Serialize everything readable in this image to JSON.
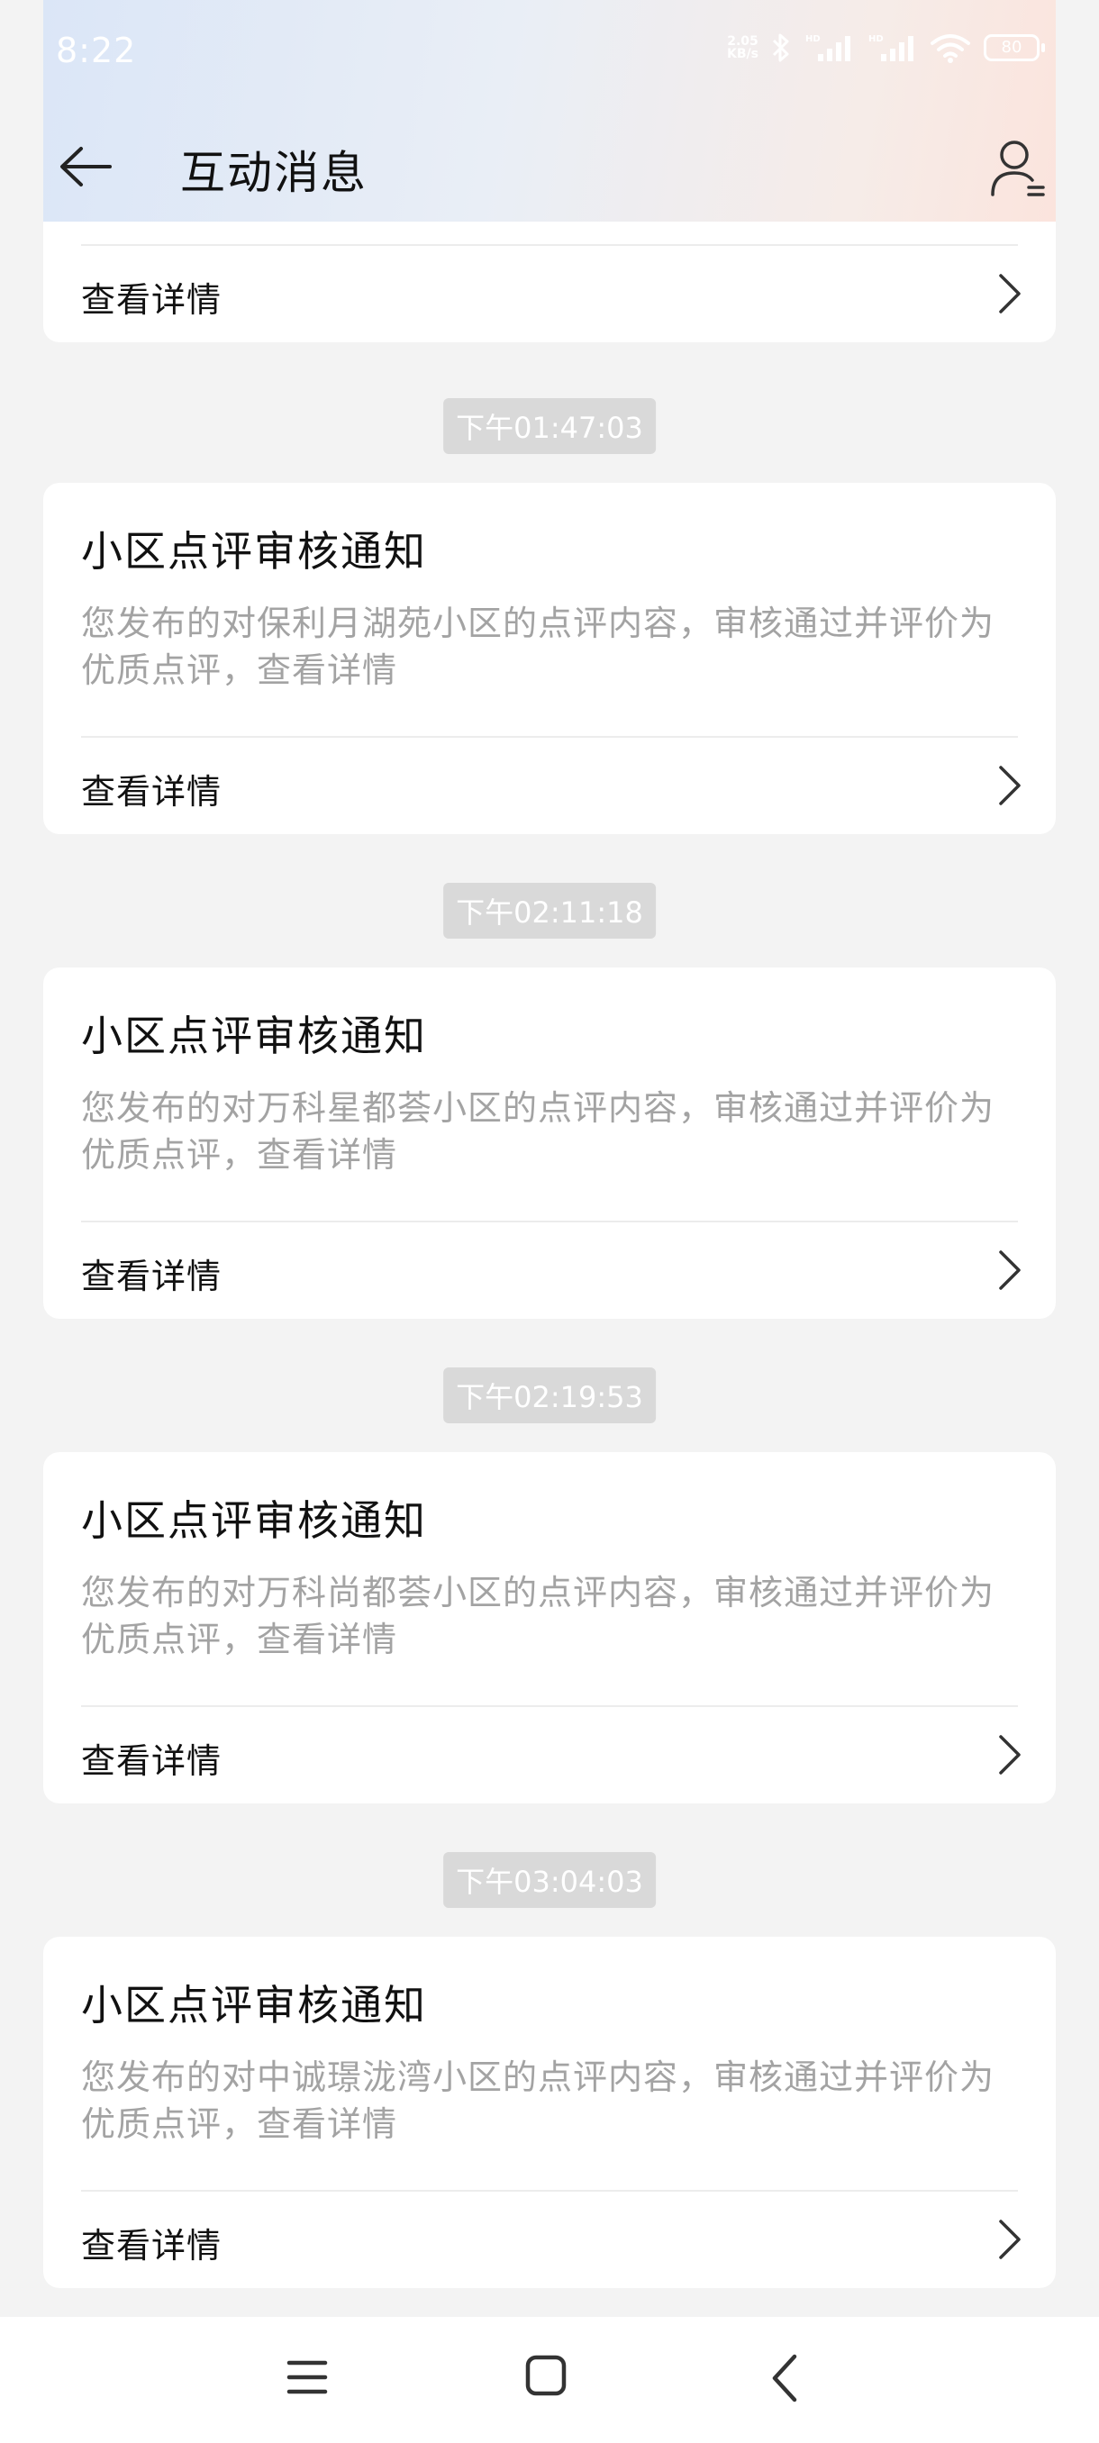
{
  "status_bar": {
    "time": "8:22",
    "net_speed_value": "2.05",
    "net_speed_unit": "KB/s",
    "battery": "80",
    "icons": [
      "bluetooth-icon",
      "signal-hd-icon",
      "signal-hd-icon",
      "wifi-icon",
      "battery-icon"
    ]
  },
  "header": {
    "title": "互动消息",
    "back_icon": "arrow-left-icon",
    "profile_icon": "user-list-icon"
  },
  "messages": [
    {
      "timestamp": "",
      "title": "",
      "body": "",
      "detail_label": "查看详情"
    },
    {
      "timestamp": "下午01:47:03",
      "title": "小区点评审核通知",
      "body": "您发布的对保利月湖苑小区的点评内容，审核通过并评价为优质点评，查看详情",
      "detail_label": "查看详情"
    },
    {
      "timestamp": "下午02:11:18",
      "title": "小区点评审核通知",
      "body": "您发布的对万科星都荟小区的点评内容，审核通过并评价为优质点评，查看详情",
      "detail_label": "查看详情"
    },
    {
      "timestamp": "下午02:19:53",
      "title": "小区点评审核通知",
      "body": "您发布的对万科尚都荟小区的点评内容，审核通过并评价为优质点评，查看详情",
      "detail_label": "查看详情"
    },
    {
      "timestamp": "下午03:04:03",
      "title": "小区点评审核通知",
      "body": "您发布的对中诚璟泷湾小区的点评内容，审核通过并评价为优质点评，查看详情",
      "detail_label": "查看详情"
    }
  ],
  "bottom_nav": {
    "icons": [
      "menu-icon",
      "home-icon",
      "back-icon"
    ]
  },
  "colors": {
    "page_background": "#f3f3f3",
    "card_background": "#ffffff",
    "body_text": "#a3a3a3",
    "timestamp_badge": "#d9d9d9"
  }
}
